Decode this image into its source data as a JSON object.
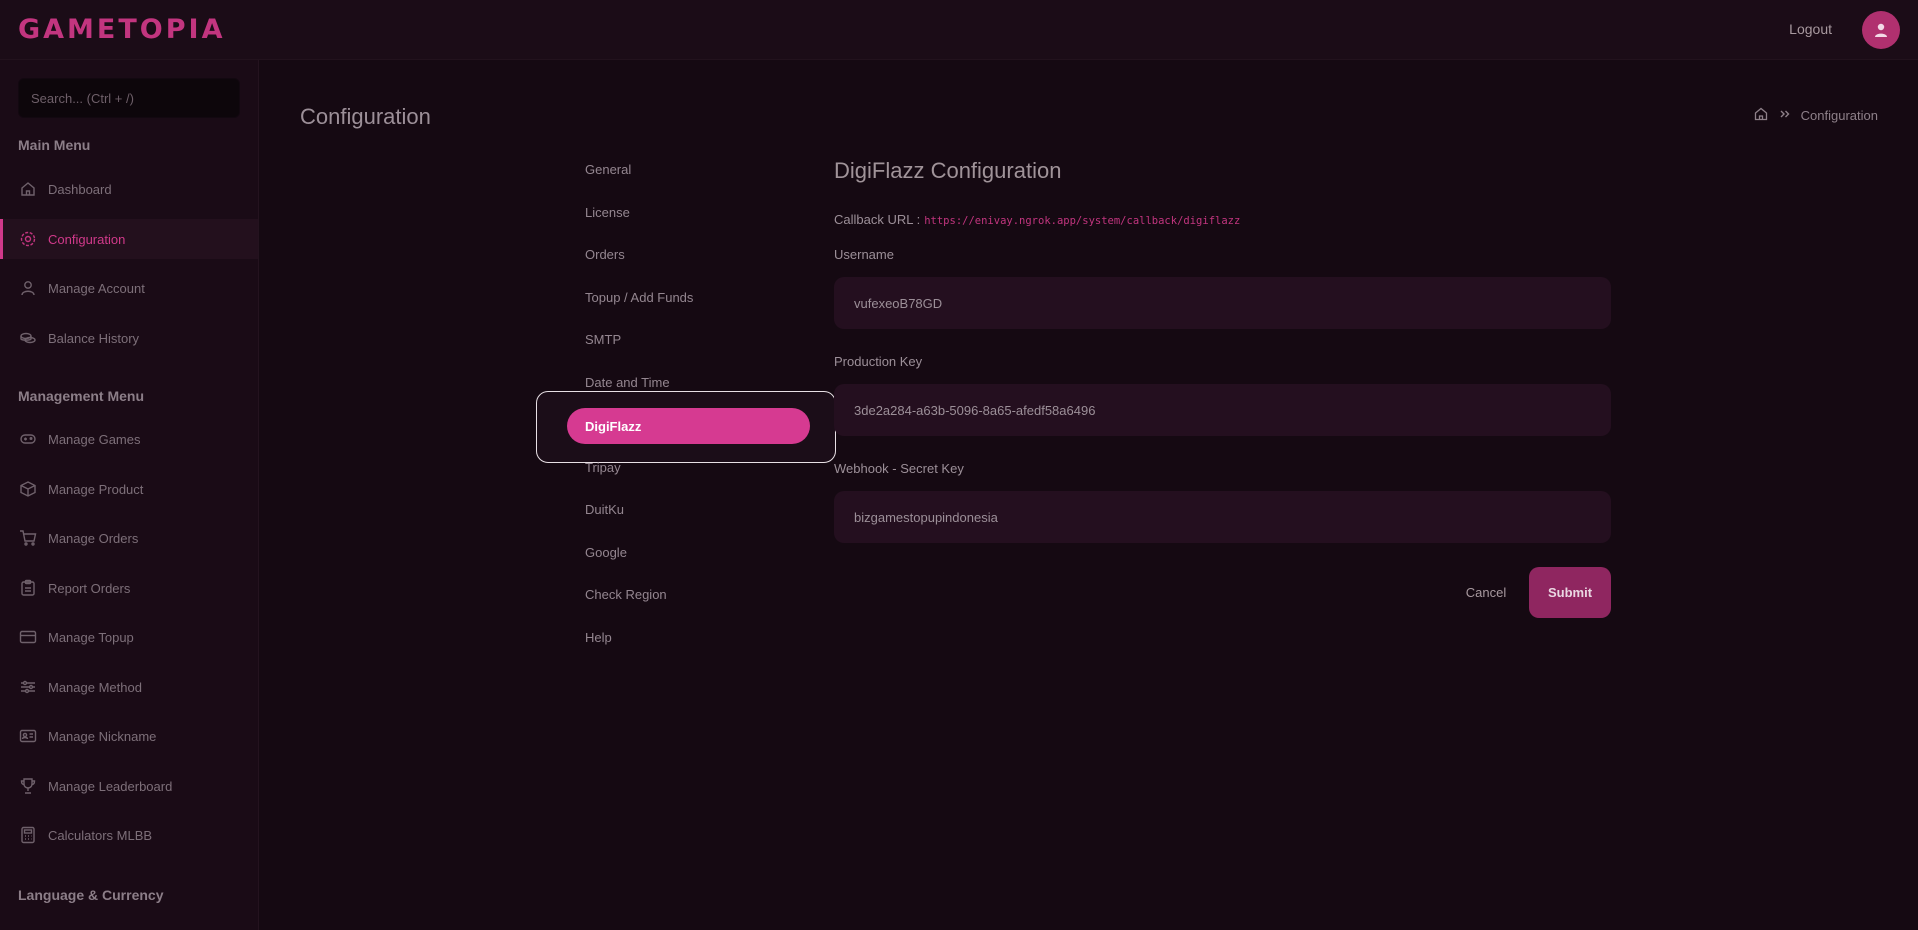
{
  "brand": {
    "logo_text": "GAMETOPIA",
    "accent": "#d63a91"
  },
  "header": {
    "logout_label": "Logout"
  },
  "search": {
    "placeholder": "Search... (Ctrl + /)"
  },
  "sidebar": {
    "main_menu_title": "Main Menu",
    "main_items": [
      {
        "label": "Dashboard",
        "icon": "home-icon"
      },
      {
        "label": "Configuration",
        "icon": "gear-icon",
        "active": true
      },
      {
        "label": "Manage Account",
        "icon": "user-icon"
      },
      {
        "label": "Balance History",
        "icon": "coins-icon"
      }
    ],
    "management_menu_title": "Management Menu",
    "management_items": [
      {
        "label": "Manage Games",
        "icon": "gamepad-icon"
      },
      {
        "label": "Manage Product",
        "icon": "box-icon"
      },
      {
        "label": "Manage Orders",
        "icon": "cart-icon"
      },
      {
        "label": "Report Orders",
        "icon": "clipboard-icon"
      },
      {
        "label": "Manage Topup",
        "icon": "card-icon"
      },
      {
        "label": "Manage Method",
        "icon": "sliders-icon"
      },
      {
        "label": "Manage Nickname",
        "icon": "id-card-icon"
      },
      {
        "label": "Manage Leaderboard",
        "icon": "trophy-icon"
      },
      {
        "label": "Calculators MLBB",
        "icon": "calculator-icon"
      }
    ],
    "language_title": "Language & Currency"
  },
  "page": {
    "title": "Configuration"
  },
  "breadcrumb": {
    "current": "Configuration"
  },
  "config_menu": {
    "items": [
      "General",
      "License",
      "Orders",
      "Topup / Add Funds",
      "SMTP",
      "Date and Time",
      "DigiFlazz",
      "Tripay",
      "DuitKu",
      "Google",
      "Check Region",
      "Help"
    ],
    "active": "DigiFlazz"
  },
  "form": {
    "title": "DigiFlazz Configuration",
    "callback_label": "Callback URL :",
    "callback_url": "https://enivay.ngrok.app/system/callback/digiflazz",
    "username_label": "Username",
    "username_value": "vufexeoB78GD",
    "production_key_label": "Production Key",
    "production_key_value": "3de2a284-a63b-5096-8a65-afedf58a6496",
    "webhook_label": "Webhook - Secret Key",
    "webhook_value": "bizgamestopupindonesia",
    "cancel_label": "Cancel",
    "submit_label": "Submit"
  }
}
